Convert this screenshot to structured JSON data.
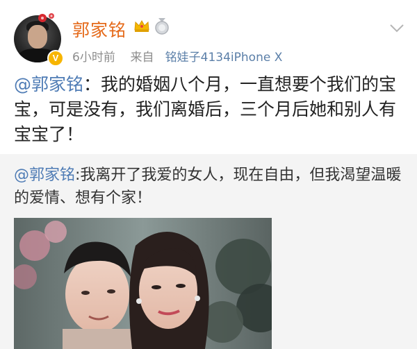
{
  "post": {
    "username": "郭家铭",
    "timestamp": "6小时前",
    "source_prefix": "来自",
    "source": "铭娃子4134iPhone X",
    "mention": "@郭家铭",
    "text": "：我的婚姻八个月，一直想要个我们的宝宝，可是没有，我们离婚后，三个月后她和别人有宝宝了！"
  },
  "repost": {
    "mention": "@郭家铭",
    "text": ":我离开了我爱的女人，现在自由，但我渴望温暖的爱情、想有个家！"
  },
  "icons": {
    "verified_badge": "V",
    "crown": "crown-icon",
    "medal": "medal-icon",
    "more": "chevron-down-icon"
  },
  "colors": {
    "username": "#e56a1a",
    "mention": "#4f7cb5",
    "meta": "#8d8d8d",
    "repost_bg": "#f4f4f4",
    "badge": "#f7b500"
  }
}
